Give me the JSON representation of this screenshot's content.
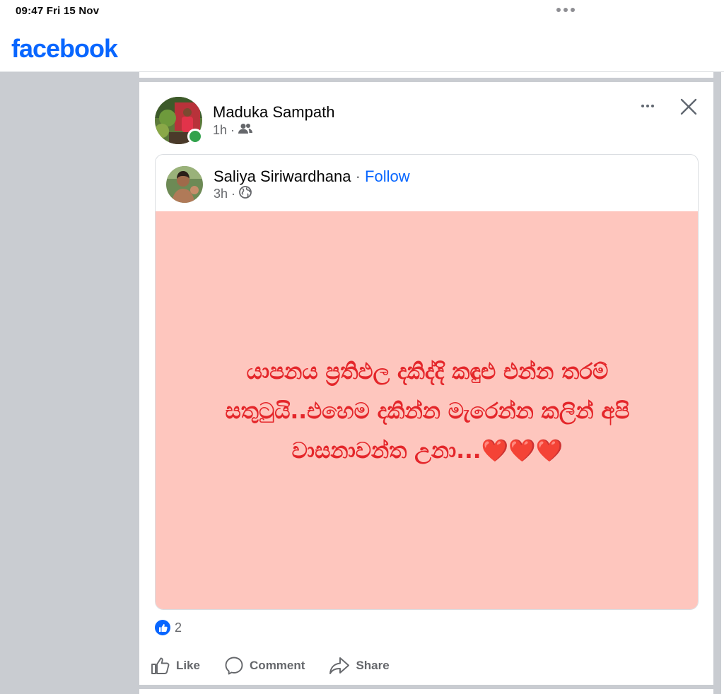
{
  "status_bar": {
    "time": "09:47  Fri 15 Nov"
  },
  "header": {
    "logo": "facebook"
  },
  "post": {
    "author": "Maduka Sampath",
    "time": "1h",
    "audience_icon": "friends-icon",
    "shared": {
      "author": "Saliya Siriwardhana",
      "separator": "·",
      "follow_label": "Follow",
      "time": "3h",
      "audience_icon": "globe-icon",
      "text": "යාපනය ප්‍රතිඵල දකිද්දි කඳුළු එන්න තරම් සතුටුයි..එහෙම දකින්න මැරෙන්න කලින් අපි වාසනාවන්ත උනා...❤️❤️❤️",
      "background_color": "#fec6be",
      "text_color": "#e4262a"
    },
    "reaction_count": "2",
    "actions": {
      "like": "Like",
      "comment": "Comment",
      "share": "Share"
    }
  },
  "colors": {
    "brand": "#0866ff",
    "online": "#31a24c"
  }
}
